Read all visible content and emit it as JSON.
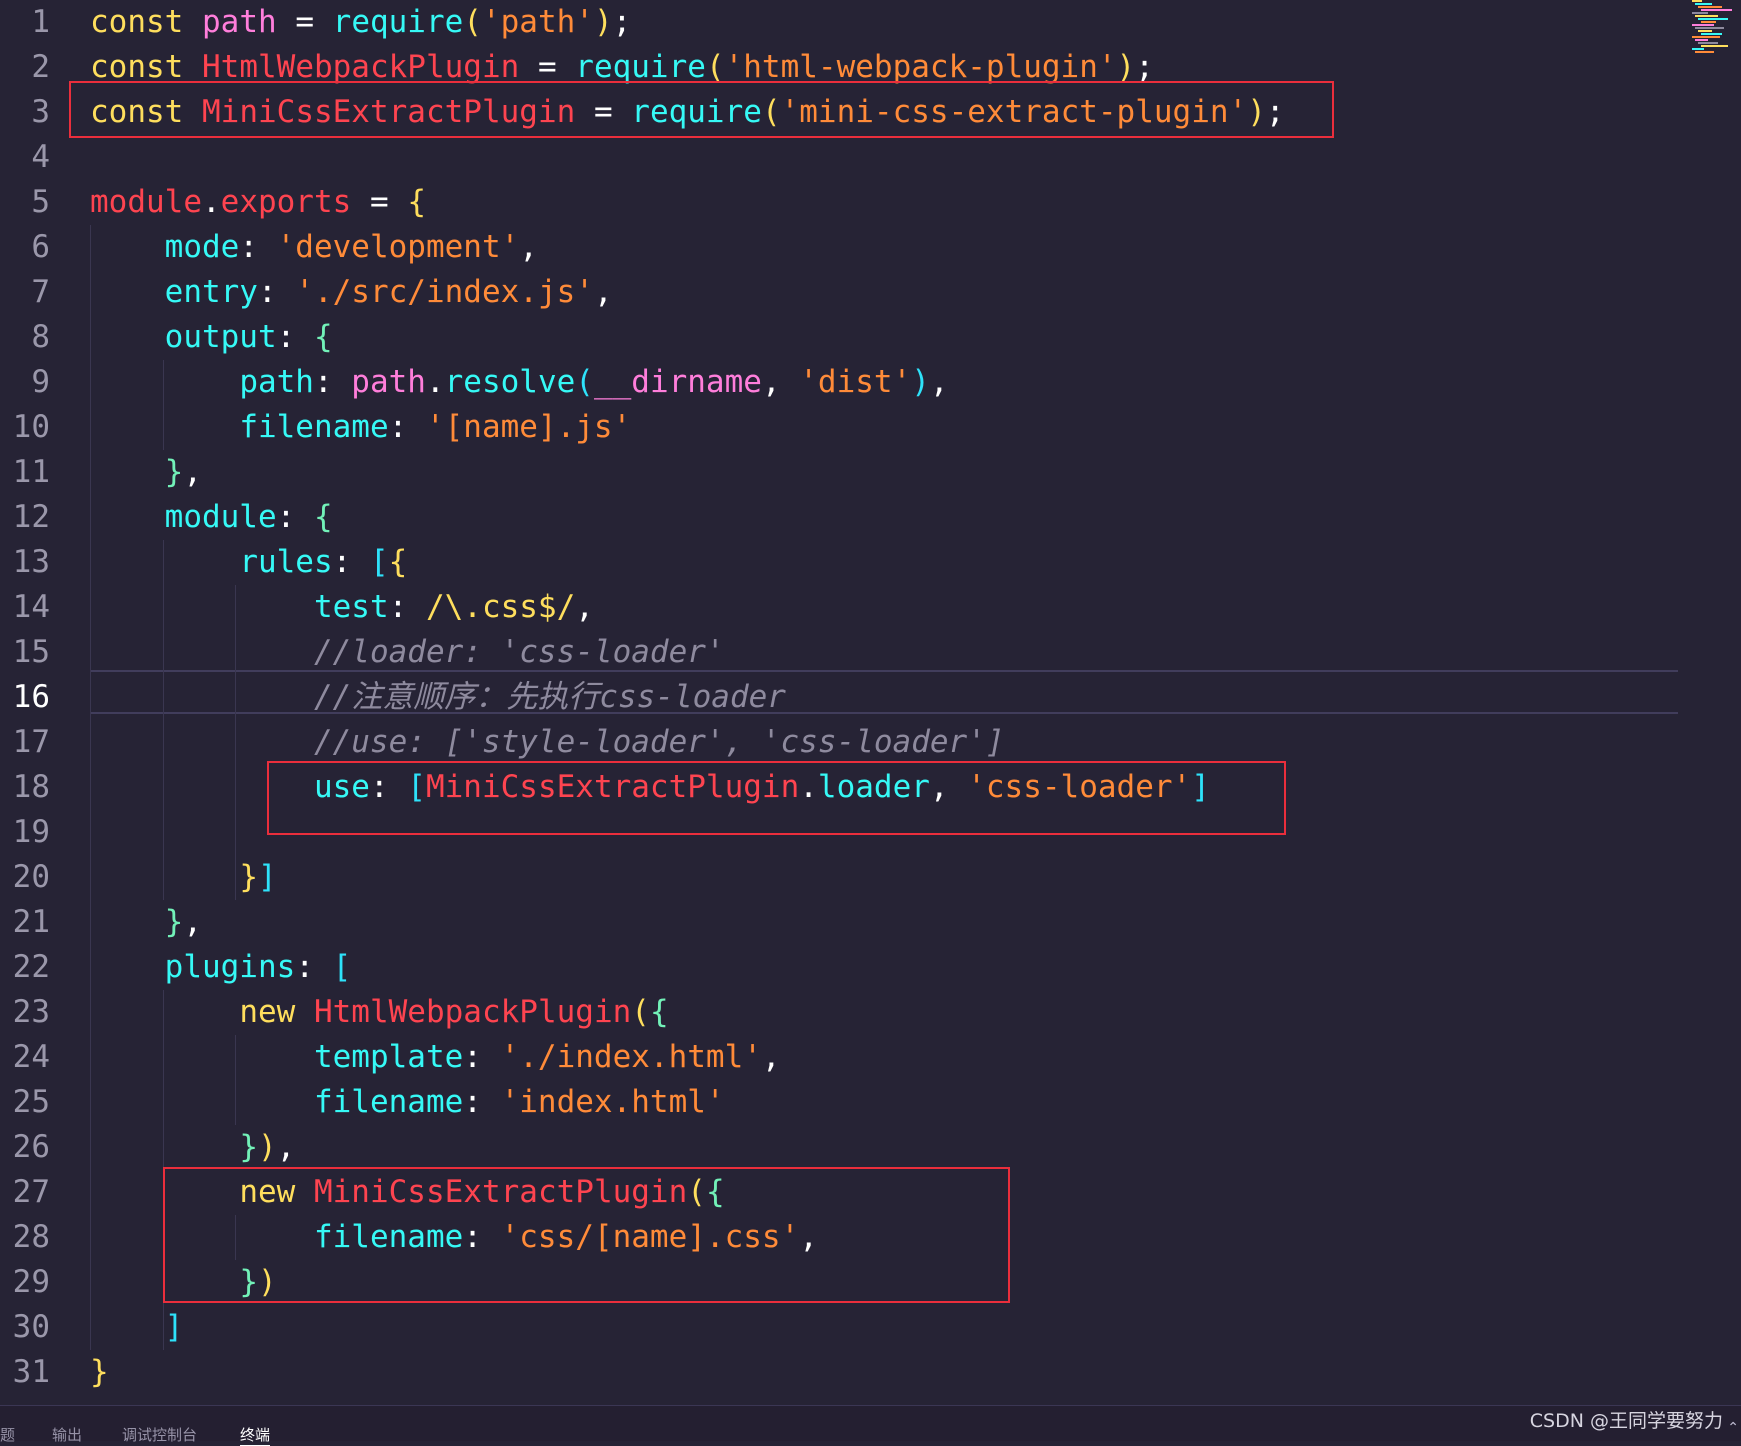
{
  "editor": {
    "language": "javascript",
    "active_line": 16,
    "lines": [
      {
        "n": "1",
        "tokens": [
          [
            "const",
            "kw"
          ],
          [
            " ",
            "punc"
          ],
          [
            "path",
            "var"
          ],
          [
            " = ",
            "punc"
          ],
          [
            "require",
            "fn"
          ],
          [
            "(",
            "br"
          ],
          [
            "'path'",
            "str"
          ],
          [
            ")",
            "br"
          ],
          [
            ";",
            "punc"
          ]
        ]
      },
      {
        "n": "2",
        "tokens": [
          [
            "const",
            "kw"
          ],
          [
            " ",
            "punc"
          ],
          [
            "HtmlWebpackPlugin",
            "cls"
          ],
          [
            " = ",
            "punc"
          ],
          [
            "require",
            "fn"
          ],
          [
            "(",
            "br"
          ],
          [
            "'html-webpack-plugin'",
            "str"
          ],
          [
            ")",
            "br"
          ],
          [
            ";",
            "punc"
          ]
        ]
      },
      {
        "n": "3",
        "tokens": [
          [
            "const",
            "kw"
          ],
          [
            " ",
            "punc"
          ],
          [
            "MiniCssExtractPlugin",
            "cls"
          ],
          [
            " = ",
            "punc"
          ],
          [
            "require",
            "fn"
          ],
          [
            "(",
            "br"
          ],
          [
            "'mini-css-extract-plugin'",
            "str"
          ],
          [
            ")",
            "br"
          ],
          [
            ";",
            "punc"
          ]
        ]
      },
      {
        "n": "4",
        "tokens": []
      },
      {
        "n": "5",
        "tokens": [
          [
            "module",
            "cls"
          ],
          [
            ".",
            "punc"
          ],
          [
            "exports",
            "cls"
          ],
          [
            " = ",
            "punc"
          ],
          [
            "{",
            "br"
          ]
        ]
      },
      {
        "n": "6",
        "tokens": [
          [
            "    ",
            "punc"
          ],
          [
            "mode",
            "prop"
          ],
          [
            ": ",
            "punc"
          ],
          [
            "'development'",
            "str"
          ],
          [
            ",",
            "punc"
          ]
        ]
      },
      {
        "n": "7",
        "tokens": [
          [
            "    ",
            "punc"
          ],
          [
            "entry",
            "prop"
          ],
          [
            ": ",
            "punc"
          ],
          [
            "'./src/index.js'",
            "str"
          ],
          [
            ",",
            "punc"
          ]
        ]
      },
      {
        "n": "8",
        "tokens": [
          [
            "    ",
            "punc"
          ],
          [
            "output",
            "prop"
          ],
          [
            ": ",
            "punc"
          ],
          [
            "{",
            "br2"
          ]
        ]
      },
      {
        "n": "9",
        "tokens": [
          [
            "        ",
            "punc"
          ],
          [
            "path",
            "prop"
          ],
          [
            ": ",
            "punc"
          ],
          [
            "path",
            "var"
          ],
          [
            ".",
            "punc"
          ],
          [
            "resolve",
            "fn"
          ],
          [
            "(",
            "br3"
          ],
          [
            "__dirname",
            "var"
          ],
          [
            ", ",
            "punc"
          ],
          [
            "'dist'",
            "str"
          ],
          [
            ")",
            "br3"
          ],
          [
            ",",
            "punc"
          ]
        ]
      },
      {
        "n": "10",
        "tokens": [
          [
            "        ",
            "punc"
          ],
          [
            "filename",
            "prop"
          ],
          [
            ": ",
            "punc"
          ],
          [
            "'[name].js'",
            "str"
          ]
        ]
      },
      {
        "n": "11",
        "tokens": [
          [
            "    ",
            "punc"
          ],
          [
            "}",
            "br2"
          ],
          [
            ",",
            "punc"
          ]
        ]
      },
      {
        "n": "12",
        "tokens": [
          [
            "    ",
            "punc"
          ],
          [
            "module",
            "prop"
          ],
          [
            ": ",
            "punc"
          ],
          [
            "{",
            "br2"
          ]
        ]
      },
      {
        "n": "13",
        "tokens": [
          [
            "        ",
            "punc"
          ],
          [
            "rules",
            "prop"
          ],
          [
            ": ",
            "punc"
          ],
          [
            "[",
            "br3"
          ],
          [
            "{",
            "br"
          ]
        ]
      },
      {
        "n": "14",
        "tokens": [
          [
            "            ",
            "punc"
          ],
          [
            "test",
            "prop"
          ],
          [
            ": ",
            "punc"
          ],
          [
            "/\\.css$/",
            "br"
          ],
          [
            ",",
            "punc"
          ]
        ]
      },
      {
        "n": "15",
        "tokens": [
          [
            "            ",
            "punc"
          ],
          [
            "//loader: 'css-loader'",
            "cmt"
          ]
        ]
      },
      {
        "n": "16",
        "tokens": [
          [
            "            ",
            "punc"
          ],
          [
            "//注意顺序：先执行css-loader",
            "cmt"
          ]
        ]
      },
      {
        "n": "17",
        "tokens": [
          [
            "            ",
            "punc"
          ],
          [
            "//use: ['style-loader', 'css-loader']",
            "cmt"
          ]
        ]
      },
      {
        "n": "18",
        "tokens": [
          [
            "            ",
            "punc"
          ],
          [
            "use",
            "prop"
          ],
          [
            ": ",
            "punc"
          ],
          [
            "[",
            "br3"
          ],
          [
            "MiniCssExtractPlugin",
            "cls"
          ],
          [
            ".",
            "punc"
          ],
          [
            "loader",
            "prop"
          ],
          [
            ", ",
            "punc"
          ],
          [
            "'css-loader'",
            "str"
          ],
          [
            "]",
            "br3"
          ]
        ]
      },
      {
        "n": "19",
        "tokens": []
      },
      {
        "n": "20",
        "tokens": [
          [
            "        ",
            "punc"
          ],
          [
            "}",
            "br"
          ],
          [
            "]",
            "br3"
          ]
        ]
      },
      {
        "n": "21",
        "tokens": [
          [
            "    ",
            "punc"
          ],
          [
            "}",
            "br2"
          ],
          [
            ",",
            "punc"
          ]
        ]
      },
      {
        "n": "22",
        "tokens": [
          [
            "    ",
            "punc"
          ],
          [
            "plugins",
            "prop"
          ],
          [
            ": ",
            "punc"
          ],
          [
            "[",
            "br3"
          ]
        ]
      },
      {
        "n": "23",
        "tokens": [
          [
            "        ",
            "punc"
          ],
          [
            "new",
            "kw"
          ],
          [
            " ",
            "punc"
          ],
          [
            "HtmlWebpackPlugin",
            "cls"
          ],
          [
            "(",
            "br"
          ],
          [
            "{",
            "br2"
          ]
        ]
      },
      {
        "n": "24",
        "tokens": [
          [
            "            ",
            "punc"
          ],
          [
            "template",
            "prop"
          ],
          [
            ": ",
            "punc"
          ],
          [
            "'./index.html'",
            "str"
          ],
          [
            ",",
            "punc"
          ]
        ]
      },
      {
        "n": "25",
        "tokens": [
          [
            "            ",
            "punc"
          ],
          [
            "filename",
            "prop"
          ],
          [
            ": ",
            "punc"
          ],
          [
            "'index.html'",
            "str"
          ]
        ]
      },
      {
        "n": "26",
        "tokens": [
          [
            "        ",
            "punc"
          ],
          [
            "}",
            "br2"
          ],
          [
            ")",
            "br"
          ],
          [
            ",",
            "punc"
          ]
        ]
      },
      {
        "n": "27",
        "tokens": [
          [
            "        ",
            "punc"
          ],
          [
            "new",
            "kw"
          ],
          [
            " ",
            "punc"
          ],
          [
            "MiniCssExtractPlugin",
            "cls"
          ],
          [
            "(",
            "br"
          ],
          [
            "{",
            "br2"
          ]
        ]
      },
      {
        "n": "28",
        "tokens": [
          [
            "            ",
            "punc"
          ],
          [
            "filename",
            "prop"
          ],
          [
            ": ",
            "punc"
          ],
          [
            "'css/[name].css'",
            "str"
          ],
          [
            ",",
            "punc"
          ]
        ]
      },
      {
        "n": "29",
        "tokens": [
          [
            "        ",
            "punc"
          ],
          [
            "}",
            "br2"
          ],
          [
            ")",
            "br"
          ]
        ]
      },
      {
        "n": "30",
        "tokens": [
          [
            "    ",
            "punc"
          ],
          [
            "]",
            "br3"
          ]
        ]
      },
      {
        "n": "31",
        "tokens": [
          [
            "}",
            "br"
          ]
        ]
      }
    ]
  },
  "colors": {
    "background": "#262335",
    "highlight_box": "#ea2e3c",
    "keyword": "#fede5d",
    "variable": "#ff7edb",
    "function": "#36f9f6",
    "string": "#ff8b39",
    "class": "#fe4450",
    "comment": "#8e8a9e"
  },
  "panel": {
    "tabs": [
      {
        "label": "题",
        "active": false
      },
      {
        "label": "输出",
        "active": false
      },
      {
        "label": "调试控制台",
        "active": false
      },
      {
        "label": "终端",
        "active": true
      }
    ]
  },
  "watermark": "CSDN @王同学要努力",
  "resize_caret": "⌃"
}
